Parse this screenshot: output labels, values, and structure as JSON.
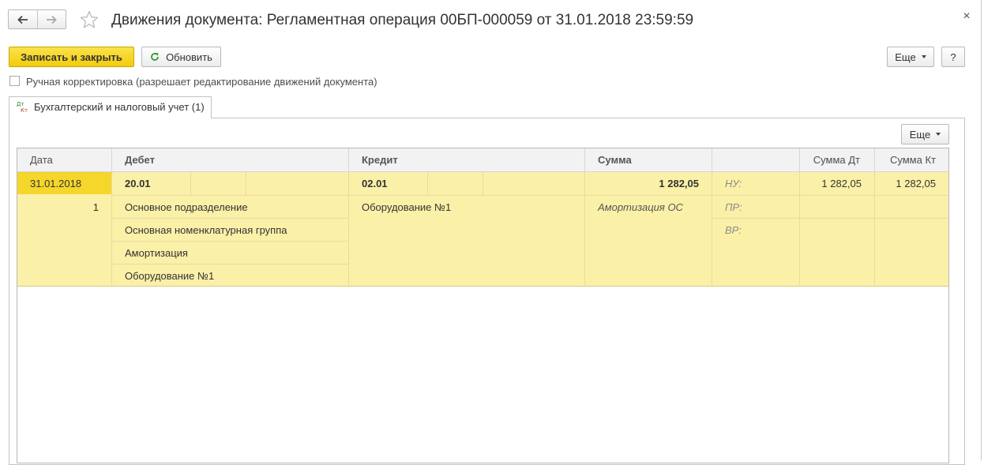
{
  "window": {
    "title": "Движения документа: Регламентная операция 00БП-000059 от 31.01.2018 23:59:59",
    "close_glyph": "×"
  },
  "toolbar": {
    "save_close_label": "Записать и закрыть",
    "refresh_label": "Обновить",
    "more_label": "Еще",
    "help_label": "?"
  },
  "manual_edit": {
    "label": "Ручная корректировка (разрешает редактирование движений документа)",
    "checked": false
  },
  "tabs": [
    {
      "label": "Бухгалтерский и налоговый учет (1)",
      "icon": "dt-kt-icon",
      "icon_text_top": "Дт",
      "icon_text_bottom": "Кт"
    }
  ],
  "panel": {
    "more_label": "Еще"
  },
  "grid": {
    "headers": {
      "date": "Дата",
      "debit": "Дебет",
      "credit": "Кредит",
      "sum": "Сумма",
      "sum_dt": "Сумма Дт",
      "sum_kt": "Сумма Кт"
    },
    "record": {
      "date": "31.01.2018",
      "line_number": "1",
      "debit_account": "20.01",
      "debit_subconto": [
        "Основное подразделение",
        "Основная номенклатурная группа",
        "Амортизация",
        "Оборудование №1"
      ],
      "credit_account": "02.01",
      "credit_subconto": [
        "Оборудование №1"
      ],
      "sum": "1 282,05",
      "content": "Амортизация ОС",
      "tax_labels": [
        "НУ:",
        "ПР:",
        "ВР:"
      ],
      "sum_dt_nu": "1 282,05",
      "sum_kt_nu": "1 282,05"
    }
  },
  "colors": {
    "primary_button": "#f2cc0c",
    "row_background": "#fbf0a8",
    "selected_cell": "#f5d62a",
    "header_background": "#f2f2f2"
  }
}
